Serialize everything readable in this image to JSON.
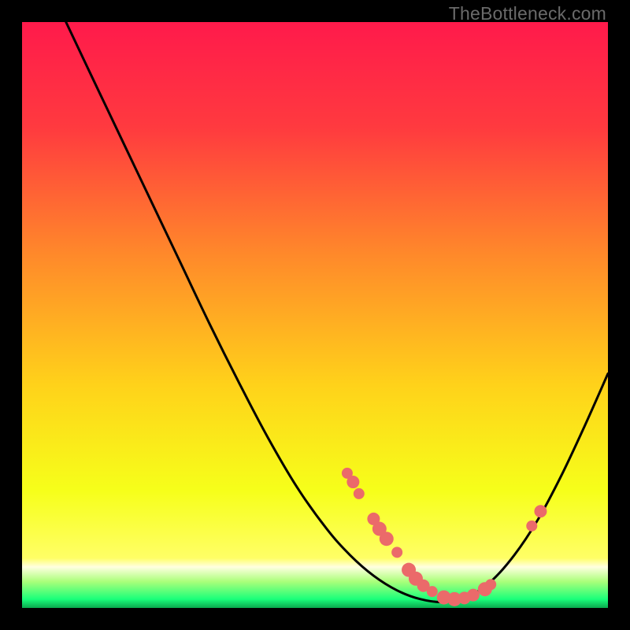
{
  "watermark": "TheBottleneck.com",
  "chart_data": {
    "type": "line",
    "title": "",
    "xlabel": "",
    "ylabel": "",
    "xlim": [
      0,
      1
    ],
    "ylim": [
      0,
      1
    ],
    "gradient_stops": [
      {
        "offset": 0.0,
        "color": "#ff1a4b"
      },
      {
        "offset": 0.18,
        "color": "#ff3a3f"
      },
      {
        "offset": 0.4,
        "color": "#ff8a2a"
      },
      {
        "offset": 0.62,
        "color": "#ffd21a"
      },
      {
        "offset": 0.8,
        "color": "#f6ff1a"
      },
      {
        "offset": 0.915,
        "color": "#ffff66"
      },
      {
        "offset": 0.93,
        "color": "#ffffe0"
      },
      {
        "offset": 0.955,
        "color": "#aaff7a"
      },
      {
        "offset": 0.985,
        "color": "#1aff7a"
      },
      {
        "offset": 1.0,
        "color": "#0aa84e"
      }
    ],
    "curve": [
      {
        "x": 0.075,
        "y": 1.0
      },
      {
        "x": 0.12,
        "y": 0.905
      },
      {
        "x": 0.17,
        "y": 0.8
      },
      {
        "x": 0.22,
        "y": 0.695
      },
      {
        "x": 0.27,
        "y": 0.59
      },
      {
        "x": 0.32,
        "y": 0.485
      },
      {
        "x": 0.37,
        "y": 0.385
      },
      {
        "x": 0.42,
        "y": 0.29
      },
      {
        "x": 0.47,
        "y": 0.205
      },
      {
        "x": 0.52,
        "y": 0.135
      },
      {
        "x": 0.56,
        "y": 0.09
      },
      {
        "x": 0.6,
        "y": 0.055
      },
      {
        "x": 0.64,
        "y": 0.03
      },
      {
        "x": 0.68,
        "y": 0.015
      },
      {
        "x": 0.72,
        "y": 0.01
      },
      {
        "x": 0.76,
        "y": 0.018
      },
      {
        "x": 0.8,
        "y": 0.045
      },
      {
        "x": 0.84,
        "y": 0.09
      },
      {
        "x": 0.88,
        "y": 0.15
      },
      {
        "x": 0.92,
        "y": 0.225
      },
      {
        "x": 0.96,
        "y": 0.31
      },
      {
        "x": 1.0,
        "y": 0.4
      }
    ],
    "markers": [
      {
        "x": 0.555,
        "y": 0.23,
        "r": 7
      },
      {
        "x": 0.565,
        "y": 0.215,
        "r": 8
      },
      {
        "x": 0.575,
        "y": 0.195,
        "r": 7
      },
      {
        "x": 0.6,
        "y": 0.152,
        "r": 8
      },
      {
        "x": 0.61,
        "y": 0.135,
        "r": 9
      },
      {
        "x": 0.622,
        "y": 0.118,
        "r": 9
      },
      {
        "x": 0.64,
        "y": 0.095,
        "r": 7
      },
      {
        "x": 0.66,
        "y": 0.065,
        "r": 9
      },
      {
        "x": 0.672,
        "y": 0.05,
        "r": 9
      },
      {
        "x": 0.685,
        "y": 0.038,
        "r": 8
      },
      {
        "x": 0.7,
        "y": 0.028,
        "r": 7
      },
      {
        "x": 0.72,
        "y": 0.018,
        "r": 9
      },
      {
        "x": 0.738,
        "y": 0.015,
        "r": 9
      },
      {
        "x": 0.755,
        "y": 0.017,
        "r": 8
      },
      {
        "x": 0.77,
        "y": 0.022,
        "r": 8
      },
      {
        "x": 0.79,
        "y": 0.032,
        "r": 9
      },
      {
        "x": 0.8,
        "y": 0.04,
        "r": 7
      },
      {
        "x": 0.87,
        "y": 0.14,
        "r": 7
      },
      {
        "x": 0.885,
        "y": 0.165,
        "r": 8
      }
    ],
    "marker_color": "#eb6a6a"
  }
}
